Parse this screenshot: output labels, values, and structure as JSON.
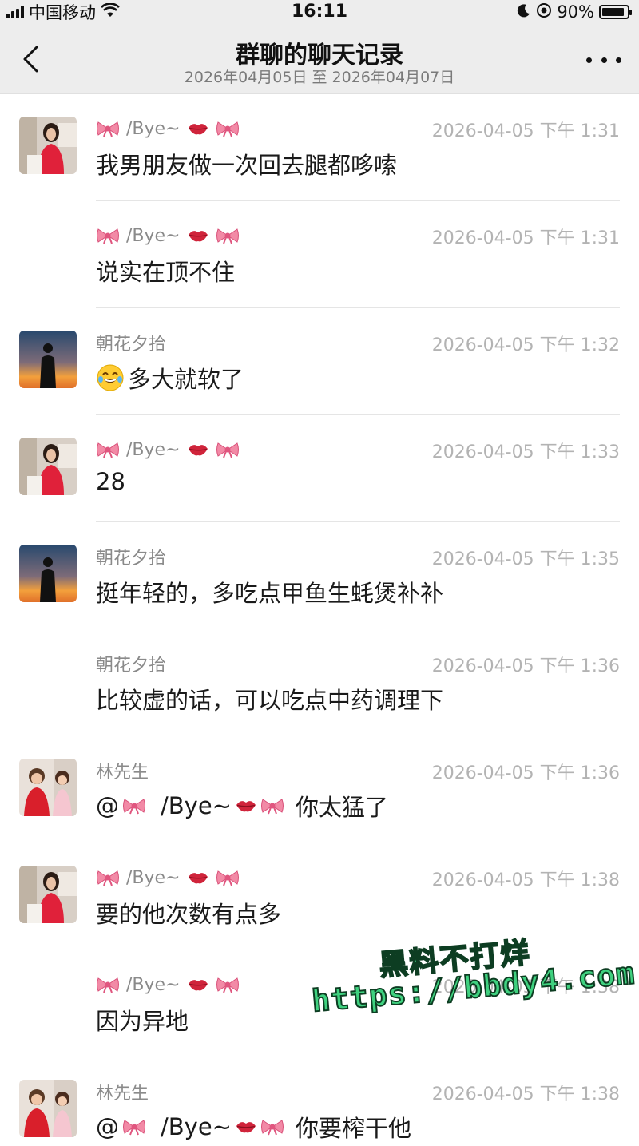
{
  "status_bar": {
    "carrier": "中国移动",
    "time": "16:11",
    "battery_text": "90%",
    "battery_level": 0.9
  },
  "nav": {
    "title": "群聊的聊天记录",
    "subtitle": "2026年04月05日 至 2026年04月07日",
    "back_icon": "chevron-left-icon",
    "more_icon": "more-dots-icon"
  },
  "messages": [
    {
      "sender": "/Bye~",
      "sender_decorated": true,
      "avatar": "avatar-woman",
      "time": "2026-04-05 下午 1:31",
      "text": "我男朋友做一次回去腿都哆嗦"
    },
    {
      "sender": "/Bye~",
      "sender_decorated": true,
      "avatar": "",
      "time": "2026-04-05 下午 1:31",
      "text": "说实在顶不住"
    },
    {
      "sender": "朝花夕拾",
      "sender_decorated": false,
      "avatar": "avatar-sunset",
      "time": "2026-04-05 下午 1:32",
      "text": "多大就软了",
      "leading_emoji": "laugh-tears-icon"
    },
    {
      "sender": "/Bye~",
      "sender_decorated": true,
      "avatar": "avatar-woman",
      "time": "2026-04-05 下午 1:33",
      "text": "28"
    },
    {
      "sender": "朝花夕拾",
      "sender_decorated": false,
      "avatar": "avatar-sunset",
      "time": "2026-04-05 下午 1:35",
      "text": "挺年轻的，多吃点甲鱼生蚝煲补补"
    },
    {
      "sender": "朝花夕拾",
      "sender_decorated": false,
      "avatar": "",
      "time": "2026-04-05 下午 1:36",
      "text": "比较虚的话，可以吃点中药调理下"
    },
    {
      "sender": "林先生",
      "sender_decorated": false,
      "avatar": "avatar-kids",
      "time": "2026-04-05 下午 1:36",
      "text": "你太猛了",
      "mention": "/Bye~"
    },
    {
      "sender": "/Bye~",
      "sender_decorated": true,
      "avatar": "avatar-woman",
      "time": "2026-04-05 下午 1:38",
      "text": "要的他次数有点多"
    },
    {
      "sender": "/Bye~",
      "sender_decorated": true,
      "avatar": "",
      "time": "2026-04-05 下午 1:38",
      "text": "因为异地"
    },
    {
      "sender": "林先生",
      "sender_decorated": false,
      "avatar": "avatar-kids",
      "time": "2026-04-05 下午 1:38",
      "text": "你要榨干他",
      "mention": "/Bye~"
    }
  ],
  "watermark": {
    "line1": "黑料不打烊",
    "line2": "https://bbdy4.com"
  },
  "colors": {
    "header_bg": "#ededed",
    "meta_text": "#8a8a8a",
    "time_text": "#b3b3b3",
    "watermark": "#3fd17f"
  }
}
